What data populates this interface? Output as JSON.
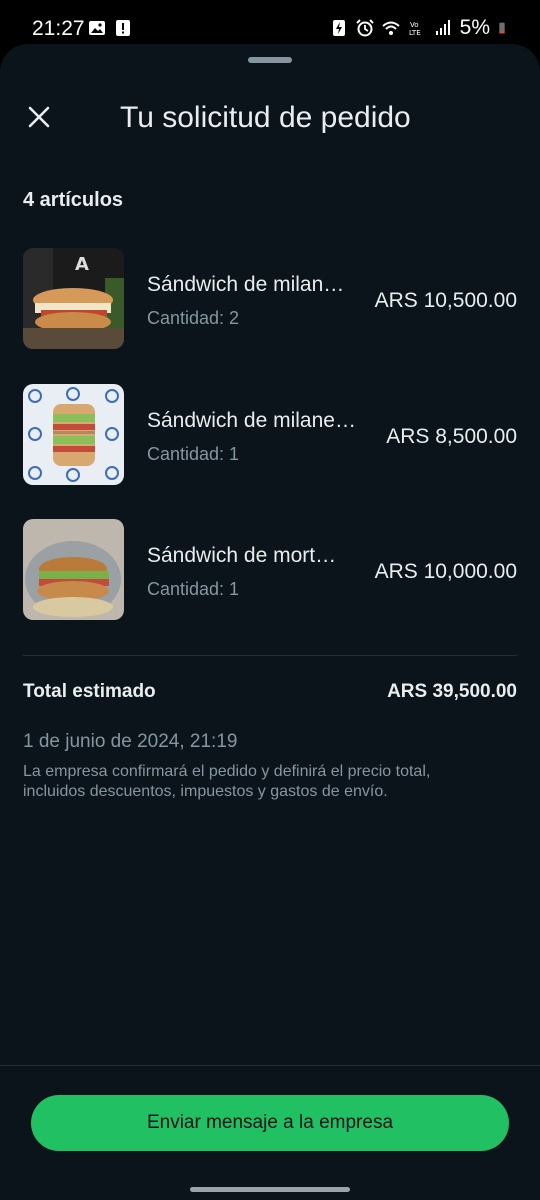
{
  "status_bar": {
    "time": "21:27",
    "battery": "5%",
    "icons": [
      "image-icon",
      "alert-icon",
      "battery-saver-icon",
      "alarm-icon",
      "wifi-icon",
      "volte-icon",
      "signal-icon",
      "battery-icon"
    ]
  },
  "header": {
    "title": "Tu solicitud de pedido",
    "close_icon": "close-icon"
  },
  "order": {
    "count_label": "4 artículos",
    "items": [
      {
        "name": "Sándwich de milan…",
        "quantity": "Cantidad: 2",
        "price": "ARS 10,500.00"
      },
      {
        "name": "Sándwich de milane…",
        "quantity": "Cantidad: 1",
        "price": "ARS 8,500.00"
      },
      {
        "name": "Sándwich de mort…",
        "quantity": "Cantidad: 1",
        "price": "ARS 10,000.00"
      }
    ],
    "total_label": "Total estimado",
    "total_value": "ARS 39,500.00",
    "date": "1 de junio de 2024, 21:19",
    "notice": "La empresa confirmará el pedido y definirá el precio total, incluidos descuentos, impuestos y gastos de envío."
  },
  "actions": {
    "message_button": "Enviar mensaje a la empresa"
  },
  "colors": {
    "background": "#0b141a",
    "accent": "#21c063",
    "secondary_text": "#8696a0"
  }
}
